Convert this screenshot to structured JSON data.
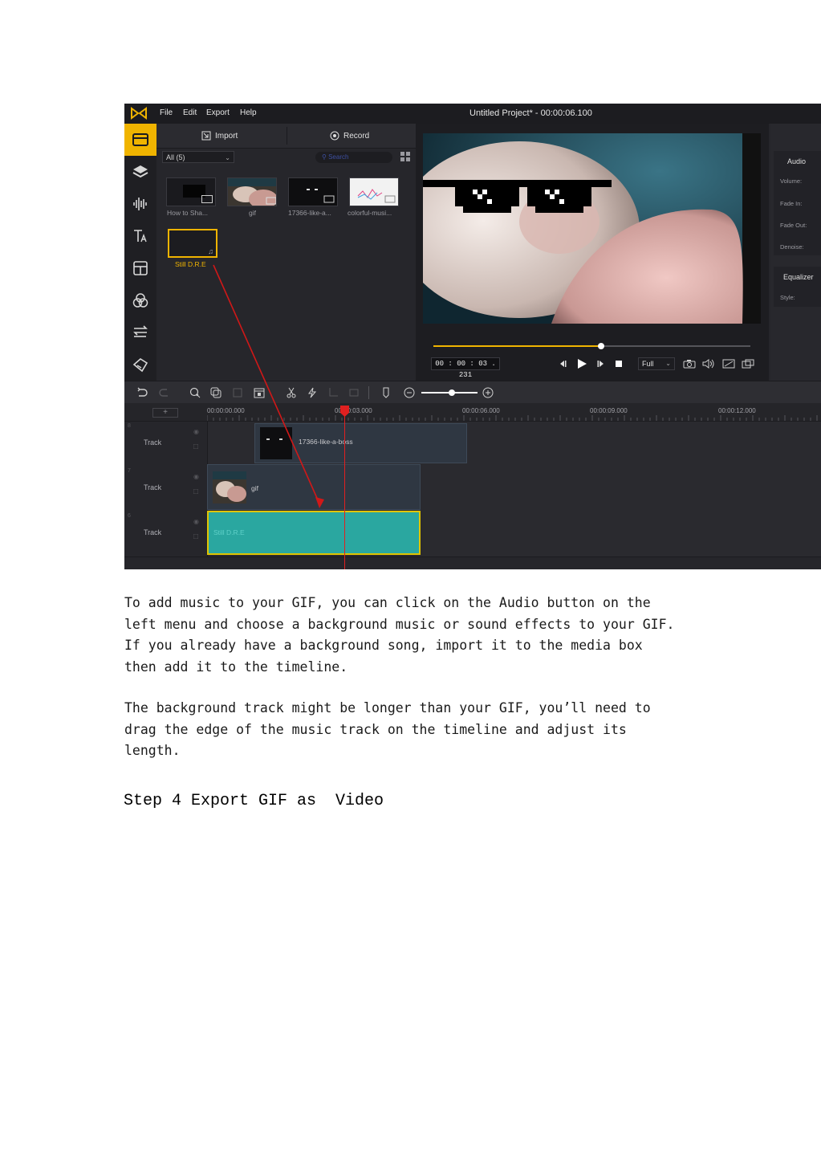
{
  "app": {
    "menu": [
      "File",
      "Edit",
      "Export",
      "Help"
    ],
    "window_title": "Untitled Project* - 00:00:06.100"
  },
  "sidebar_icons": [
    "folder-icon",
    "layers-icon",
    "audio-waveform-icon",
    "text-icon",
    "template-icon",
    "filters-icon",
    "transitions-icon",
    "stickers-icon"
  ],
  "media": {
    "import_label": "Import",
    "record_label": "Record",
    "filter_value": "All (5)",
    "search_placeholder": "Search",
    "items": [
      {
        "label": "How to Sha..."
      },
      {
        "label": "gif"
      },
      {
        "label": "17366-like-a..."
      },
      {
        "label": "colorful-musi..."
      },
      {
        "label": "Still D.R.E"
      }
    ]
  },
  "player": {
    "timecode": "00 : 00 : 03 . 231",
    "progress": 0.53,
    "zoom_value": "Full"
  },
  "properties": {
    "audio_heading": "Audio",
    "labels": [
      "Volume:",
      "Fade In:",
      "Fade Out:",
      "Denoise:"
    ],
    "equalizer_heading": "Equalizer",
    "style_label": "Style:"
  },
  "timeline": {
    "add_label": "+",
    "ticks": [
      "00:00:00.000",
      "00:00:03.000",
      "00:00:06.000",
      "00:00:09.000",
      "00:00:12.000"
    ],
    "tracks": [
      {
        "number": "8",
        "name": "Track",
        "clip": "17366-like-a-boss"
      },
      {
        "number": "7",
        "name": "Track",
        "clip": "gif"
      },
      {
        "number": "6",
        "name": "Track",
        "clip": "Still D.R.E"
      }
    ]
  },
  "colors": {
    "accent": "#f0b400",
    "annotation_arrow": "#d01818",
    "audio_clip": "#2aa7a0"
  },
  "doc": {
    "paragraph1": [
      "To add music to your GIF, you can click on the Audio button on the",
      "left menu and choose a background music or sound effects to your GIF.",
      "If you already have a background song, import it to the media box",
      "then add it to the timeline."
    ],
    "paragraph2": [
      "The background track might be longer than your GIF, you’ll need to",
      "drag the edge of the music track on the timeline and adjust its",
      "length."
    ],
    "heading": "Step 4 Export GIF as  Video"
  }
}
